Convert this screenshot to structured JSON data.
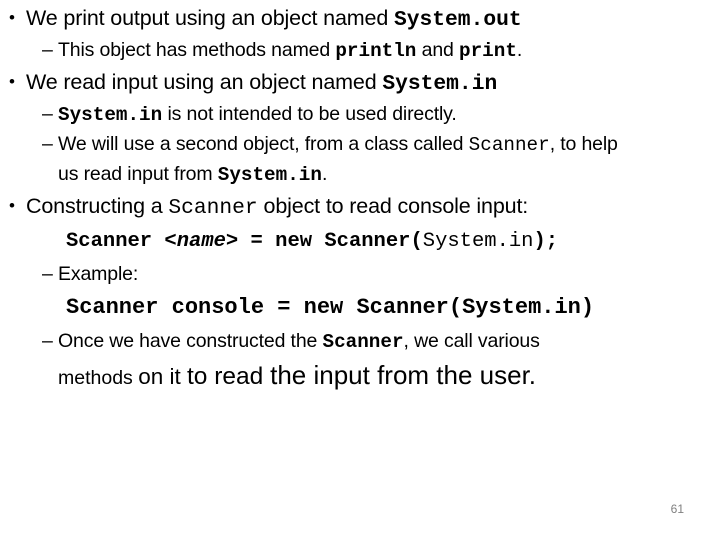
{
  "slide": {
    "page_number": "61",
    "page_number_color": "#808080",
    "background_color": "#ffffff",
    "text_color": "#000000",
    "bullet_marker": "•",
    "dash_marker": "–",
    "content": [
      {
        "level": 1,
        "plain": "We print output using an object named System.out",
        "lead": "We print output using an object named ",
        "code": "System.out"
      },
      {
        "level": 2,
        "plain": "This object has methods named println and print.",
        "lead": "This object has methods named ",
        "code1": "println",
        "mid": " and ",
        "code2": "print",
        "tail": "."
      },
      {
        "level": 1,
        "plain": "We read input using an object named System.in",
        "lead": "We read input using an object named ",
        "code": "System.in"
      },
      {
        "level": 2,
        "plain": "System.in is not intended to be used directly.",
        "code1": "System.in",
        "tail": " is not intended to be used directly."
      },
      {
        "level": 2,
        "plain": "We will use a second object, from a class called Scanner, to help us read input from System.in.",
        "lead": "We will use a second object, from a class called ",
        "code1": "Scanner",
        "mid": ", to help",
        "wrap_lead": "us read input from ",
        "code2": "System.in",
        "tail": "."
      },
      {
        "level": 1,
        "plain": "Constructing a Scanner object to read console input:",
        "lead": "Constructing a ",
        "code": "Scanner",
        "tail": " object to read console input:"
      },
      {
        "level": "code",
        "plain": "Scanner <name> = new Scanner(System.in);",
        "part1": "Scanner ",
        "part2": "<name>",
        "part3": " = new Scanner(",
        "part4": "System.in",
        "part5": ");"
      },
      {
        "level": 2,
        "plain": "Example:"
      },
      {
        "level": "code",
        "plain": "Scanner console = new Scanner(System.in)"
      },
      {
        "level": 2,
        "plain": "Once we have constructed the Scanner, we call various methods on it to read the input from the user.",
        "lead": "Once we have constructed the ",
        "code1": "Scanner",
        "tail": ", we call various",
        "wrap_w1": "methods ",
        "wrap_w2": "on it ",
        "wrap_w3": "to read ",
        "wrap_w4": "the input from the user."
      }
    ]
  }
}
